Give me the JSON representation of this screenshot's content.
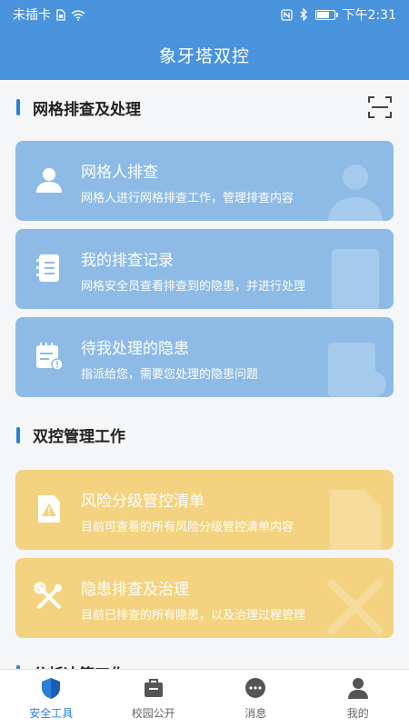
{
  "status_bar": {
    "carrier": "未插卡",
    "time": "下午2:31",
    "battery_level": 0.8,
    "icons": [
      "sim-icon",
      "wifi-icon",
      "nfc-icon",
      "bluetooth-icon",
      "battery-icon"
    ]
  },
  "header": {
    "title": "象牙塔双控"
  },
  "sections": [
    {
      "title": "网格排查及处理",
      "action_icon": "scan-icon",
      "cards": [
        {
          "title": "网格人排查",
          "desc": "网格人进行网格排查工作，管理排查内容",
          "icon": "user-icon",
          "color": "#8dbbe6"
        },
        {
          "title": "我的排查记录",
          "desc": "网格安全员查看排查到的隐患，并进行处理",
          "icon": "notebook-icon",
          "color": "#8dbbe6"
        },
        {
          "title": "待我处理的隐患",
          "desc": "指派给您，需要您处理的隐患问题",
          "icon": "calendar-alert-icon",
          "color": "#8dbbe6"
        }
      ]
    },
    {
      "title": "双控管理工作",
      "cards": [
        {
          "title": "风险分级管控清单",
          "desc": "目前可查看的所有风险分级管控清单内容",
          "icon": "warning-doc-icon",
          "color": "#f3d37f"
        },
        {
          "title": "隐患排查及治理",
          "desc": "目前已排查的所有隐患，以及治理过程管理",
          "icon": "tools-icon",
          "color": "#f3d37f"
        }
      ]
    },
    {
      "title": "分析决策工作"
    }
  ],
  "tabbar": {
    "active_color": "#2a7fd8",
    "tabs": [
      {
        "label": "安全工具",
        "icon": "shield-icon",
        "active": true
      },
      {
        "label": "校园公开",
        "icon": "briefcase-icon",
        "active": false
      },
      {
        "label": "消息",
        "icon": "message-icon",
        "active": false
      },
      {
        "label": "我的",
        "icon": "person-icon",
        "active": false
      }
    ]
  }
}
